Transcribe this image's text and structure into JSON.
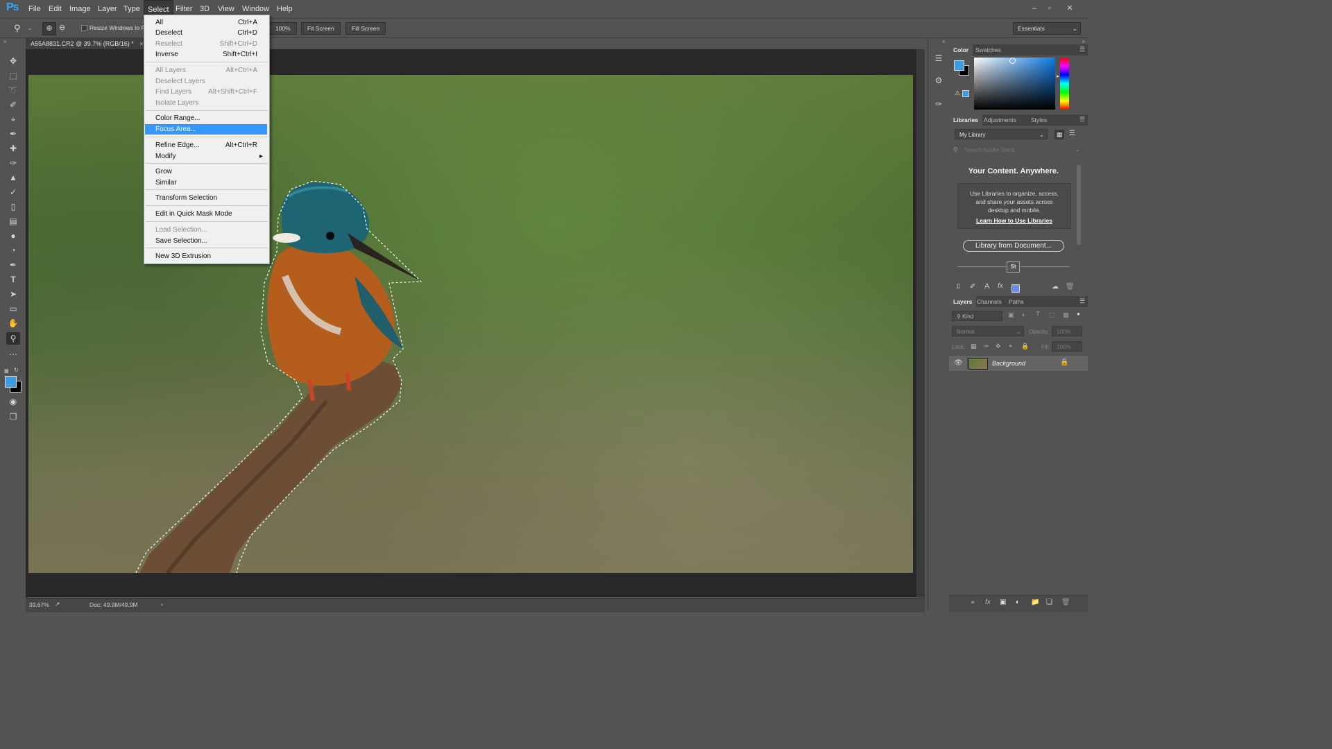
{
  "app": {
    "logo": "Ps"
  },
  "menubar": {
    "items": [
      "File",
      "Edit",
      "Image",
      "Layer",
      "Type",
      "Select",
      "Filter",
      "3D",
      "View",
      "Window",
      "Help"
    ],
    "active": "Select"
  },
  "window_controls": {
    "minimize": "–",
    "restore": "▫",
    "close": "✕"
  },
  "options": {
    "resize_windows_label": "Resize Windows to Fit",
    "zoom_100": "100%",
    "fit_screen": "Fit Screen",
    "fill_screen": "Fill Screen",
    "workspace": "Essentials"
  },
  "document": {
    "tab_title": "A55A8831.CR2 @ 39.7% (RGB/16) *",
    "tab_close": "×"
  },
  "status": {
    "zoom": "39.67%",
    "doc_size": "Doc: 49.9M/49.9M",
    "arrow": "›"
  },
  "select_menu": {
    "items": [
      {
        "label": "All",
        "shortcut": "Ctrl+A",
        "disabled": false
      },
      {
        "label": "Deselect",
        "shortcut": "Ctrl+D",
        "disabled": false
      },
      {
        "label": "Reselect",
        "shortcut": "Shift+Ctrl+D",
        "disabled": true
      },
      {
        "label": "Inverse",
        "shortcut": "Shift+Ctrl+I",
        "disabled": false
      },
      {
        "label": "All Layers",
        "shortcut": "Alt+Ctrl+A",
        "disabled": true
      },
      {
        "label": "Deselect Layers",
        "shortcut": "",
        "disabled": true
      },
      {
        "label": "Find Layers",
        "shortcut": "Alt+Shift+Ctrl+F",
        "disabled": true
      },
      {
        "label": "Isolate Layers",
        "shortcut": "",
        "disabled": true
      },
      {
        "label": "Color Range...",
        "shortcut": "",
        "disabled": false
      },
      {
        "label": "Focus Area...",
        "shortcut": "",
        "disabled": false,
        "highlighted": true
      },
      {
        "label": "Refine Edge...",
        "shortcut": "Alt+Ctrl+R",
        "disabled": false
      },
      {
        "label": "Modify",
        "shortcut": "",
        "disabled": false,
        "submenu": "▸"
      },
      {
        "label": "Grow",
        "shortcut": "",
        "disabled": false
      },
      {
        "label": "Similar",
        "shortcut": "",
        "disabled": false
      },
      {
        "label": "Transform Selection",
        "shortcut": "",
        "disabled": false
      },
      {
        "label": "Edit in Quick Mask Mode",
        "shortcut": "",
        "disabled": false
      },
      {
        "label": "Load Selection...",
        "shortcut": "",
        "disabled": true
      },
      {
        "label": "Save Selection...",
        "shortcut": "",
        "disabled": false
      },
      {
        "label": "New 3D Extrusion",
        "shortcut": "",
        "disabled": false
      }
    ]
  },
  "color_panel": {
    "tabs": [
      "Color",
      "Swatches"
    ],
    "foreground": "#3d9be0",
    "background": "#000000"
  },
  "libraries_panel": {
    "tabs": [
      "Libraries",
      "Adjustments",
      "Styles"
    ],
    "library_name": "My Library",
    "search_placeholder": "Search Adobe Stock",
    "heading": "Your Content. Anywhere.",
    "body": "Use Libraries to organize, access, and share your assets across desktop and mobile.",
    "link": "Learn How to Use Libraries",
    "button": "Library from Document...",
    "stock_badge": "St"
  },
  "layers_panel": {
    "tabs": [
      "Layers",
      "Channels",
      "Paths"
    ],
    "filter_kind": "Kind",
    "blend_mode": "Normal",
    "opacity_label": "Opacity:",
    "opacity_value": "100%",
    "lock_label": "Lock:",
    "fill_label": "Fill:",
    "fill_value": "100%",
    "layers": [
      {
        "name": "Background",
        "visible": true,
        "locked": true
      }
    ]
  },
  "colors": {
    "accent": "#3399ff",
    "ps_blue": "#31a8ff"
  }
}
